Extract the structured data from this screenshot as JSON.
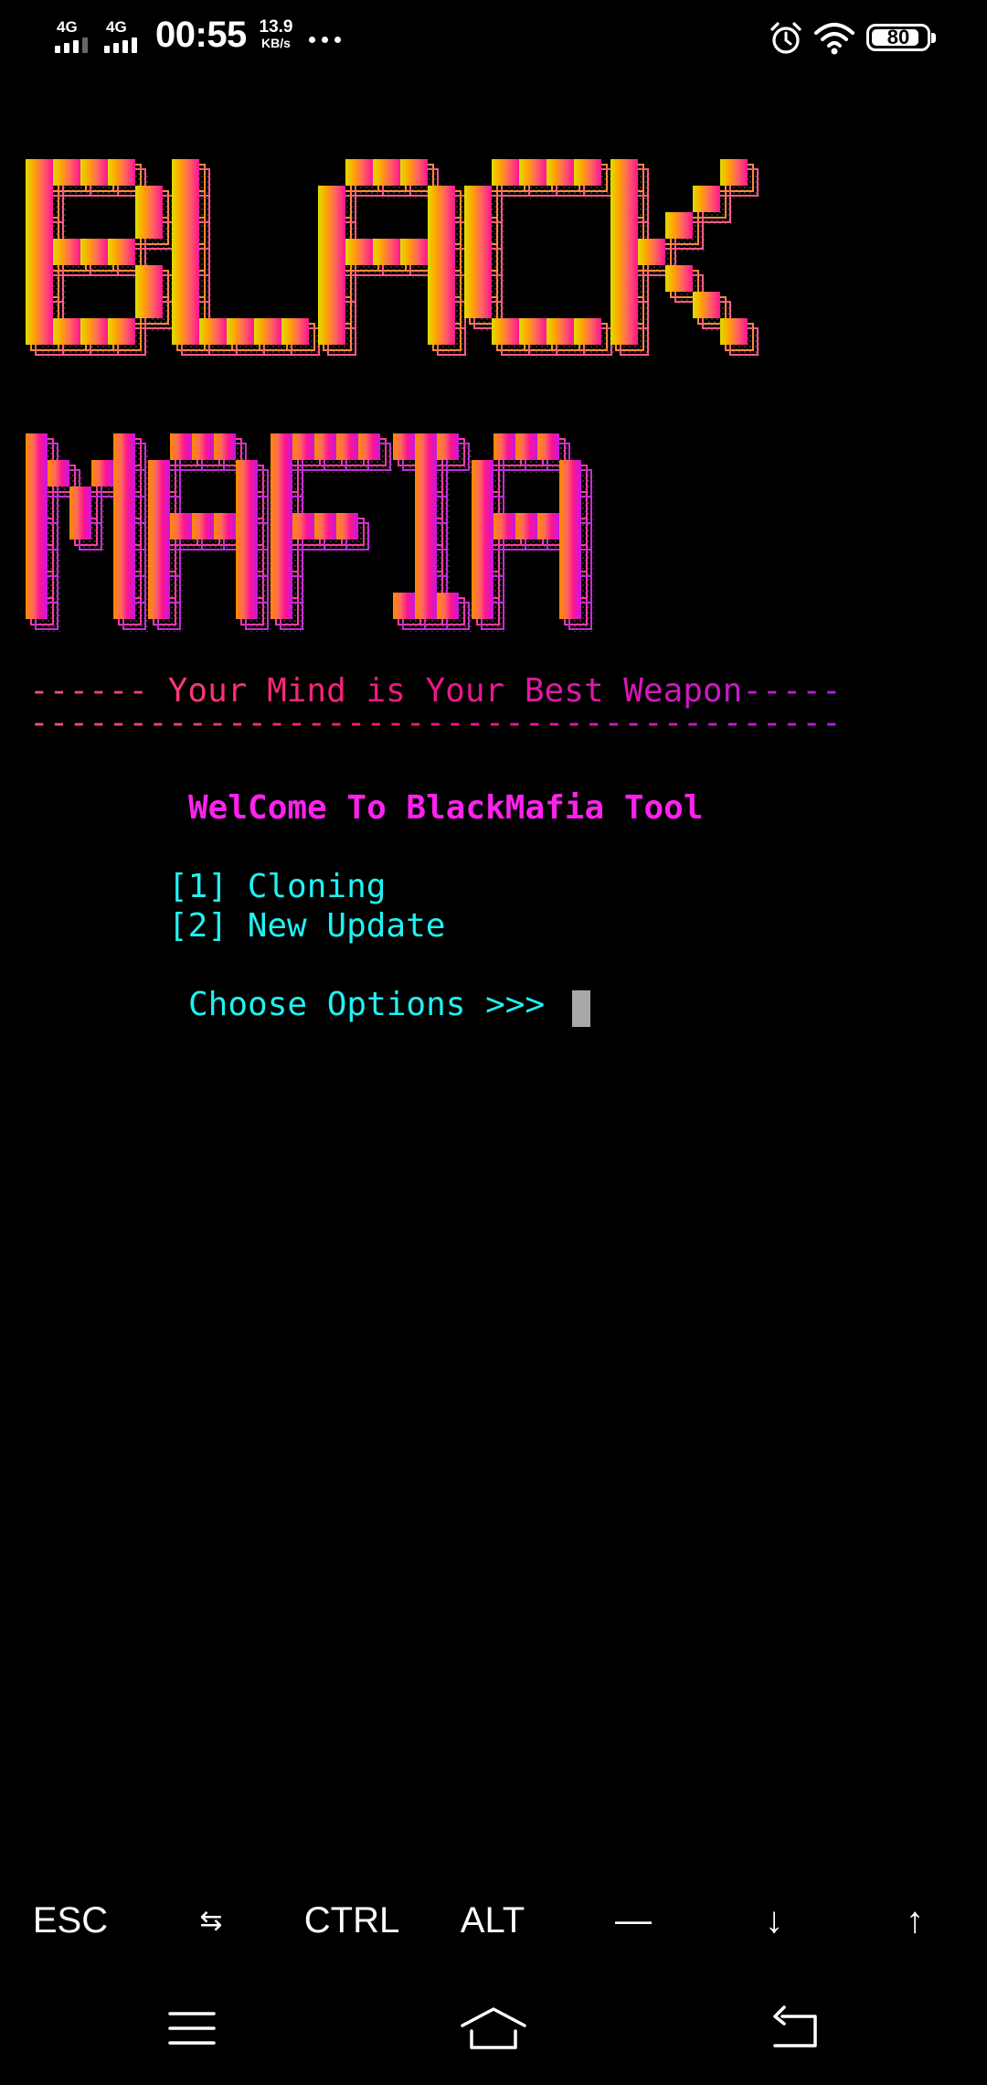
{
  "status_bar": {
    "network_1": "4G",
    "network_2": "4G",
    "time": "00:55",
    "speed_value": "13.9",
    "speed_unit": "KB/s",
    "more_icon": "more-dots-icon",
    "alarm_icon": "alarm-icon",
    "wifi_icon": "wifi-icon",
    "battery": "80"
  },
  "terminal": {
    "banner_words": [
      "BLACK",
      "MAFIA"
    ],
    "motto": "------ Your Mind is Your Best Weapon-----",
    "rule": "-----------------------------------------",
    "welcome": "WelCome To BlackMafia Tool",
    "options": [
      "[1] Cloning",
      "[2] New Update"
    ],
    "prompt": "Choose Options >>> ",
    "colors": {
      "welcome": "#ff21ee",
      "options": "#21f1f0",
      "cursor": "#a8a8a8",
      "gradient": [
        "#dedd00",
        "#ffa500",
        "#ff6a5a",
        "#ff1493",
        "#c518e0"
      ]
    }
  },
  "extra_keys": {
    "esc": "ESC",
    "tab": "⇆",
    "ctrl": "CTRL",
    "alt": "ALT",
    "dash": "—",
    "down": "↓",
    "up": "↑"
  },
  "nav_bar": {
    "menu_icon": "menu-icon",
    "home_icon": "home-icon",
    "back_icon": "back-icon"
  }
}
